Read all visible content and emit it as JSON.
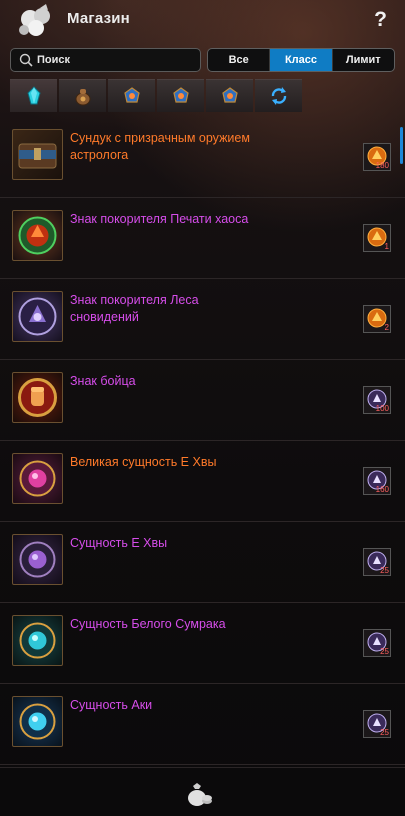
{
  "header": {
    "title": "Магазин",
    "help": "?"
  },
  "search": {
    "placeholder": "Поиск"
  },
  "filters": [
    {
      "label": "Все",
      "active": false
    },
    {
      "label": "Класс",
      "active": true
    },
    {
      "label": "Лимит",
      "active": false
    }
  ],
  "categories": [
    {
      "icon": "crystal-icon",
      "active": true
    },
    {
      "icon": "pouch-icon",
      "active": false
    },
    {
      "icon": "emblem-icon",
      "active": false
    },
    {
      "icon": "emblem-icon",
      "active": false
    },
    {
      "icon": "emblem-icon",
      "active": false
    },
    {
      "icon": "refresh-icon",
      "active": false
    }
  ],
  "items": [
    {
      "name": "Сундук с призрачным оружием астролога",
      "rarity": "orange",
      "icon": "chest-icon",
      "price_icon": "gold-token-icon",
      "price": "180"
    },
    {
      "name": "Знак покорителя Печати хаоса",
      "rarity": "purple",
      "icon": "chaos-seal-icon",
      "price_icon": "gold-token-icon",
      "price": "1"
    },
    {
      "name": "Знак покорителя Леса сновидений",
      "rarity": "purple",
      "icon": "dream-forest-icon",
      "price_icon": "gold-token-icon",
      "price": "2"
    },
    {
      "name": "Знак бойца",
      "rarity": "purple",
      "icon": "fist-icon",
      "price_icon": "purple-token-icon",
      "price": "100"
    },
    {
      "name": "Великая сущность Е Хвы",
      "rarity": "orange",
      "icon": "great-essence-icon",
      "price_icon": "purple-token-icon",
      "price": "160"
    },
    {
      "name": "Сущность Е Хвы",
      "rarity": "purple",
      "icon": "essence-icon",
      "price_icon": "purple-token-icon",
      "price": "25"
    },
    {
      "name": "Сущность Белого Сумрака",
      "rarity": "purple",
      "icon": "white-twilight-essence-icon",
      "price_icon": "purple-token-icon",
      "price": "25"
    },
    {
      "name": "Сущность Аки",
      "rarity": "purple",
      "icon": "aki-essence-icon",
      "price_icon": "purple-token-icon",
      "price": "25"
    }
  ],
  "footer": {
    "icon": "money-bag-icon"
  },
  "colors": {
    "orange": "#ff7a2a",
    "purple": "#d64dea",
    "active_filter": "#0f7cc4"
  }
}
